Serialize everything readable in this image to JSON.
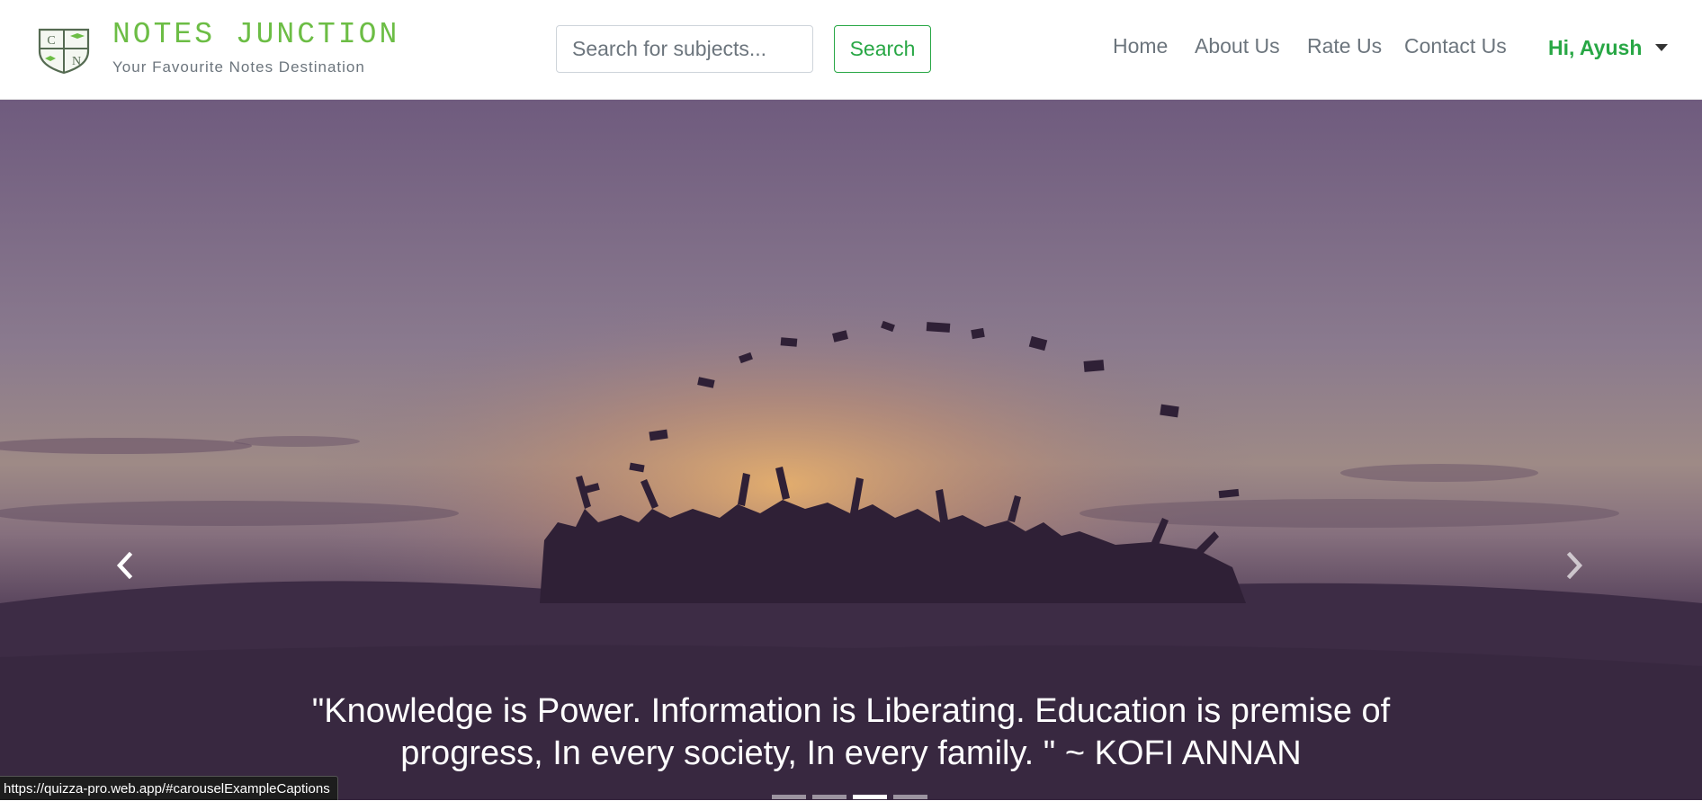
{
  "brand": {
    "name": "NOTES JUNCTION",
    "tagline": "Your Favourite Notes Destination",
    "logo_letters": [
      "C",
      "N"
    ]
  },
  "search": {
    "placeholder": "Search for subjects...",
    "button_label": "Search"
  },
  "nav": {
    "items": [
      {
        "label": "Home"
      },
      {
        "label": "About Us"
      },
      {
        "label": "Rate Us"
      },
      {
        "label": "Contact Us"
      }
    ],
    "user_label": "Hi, Ayush"
  },
  "carousel": {
    "caption_line1": "\"Knowledge is Power.  Information is Liberating. Education is premise of",
    "caption_line2": "progress, In every society, In every family. \" ~ KOFI ANNAN",
    "indicator_count": 4,
    "active_indicator": 3,
    "prev_icon": "chevron-left-icon",
    "next_icon": "chevron-right-icon"
  },
  "status_bar": {
    "url": "https://quizza-pro.web.app/#carouselExampleCaptions"
  },
  "colors": {
    "brand_green": "#6cbd45",
    "button_green": "#28a745",
    "nav_text": "#6c757d",
    "hero_sky_top": "#6d5a7c",
    "hero_glow": "#d99a58",
    "silhouette": "#3a2942"
  }
}
